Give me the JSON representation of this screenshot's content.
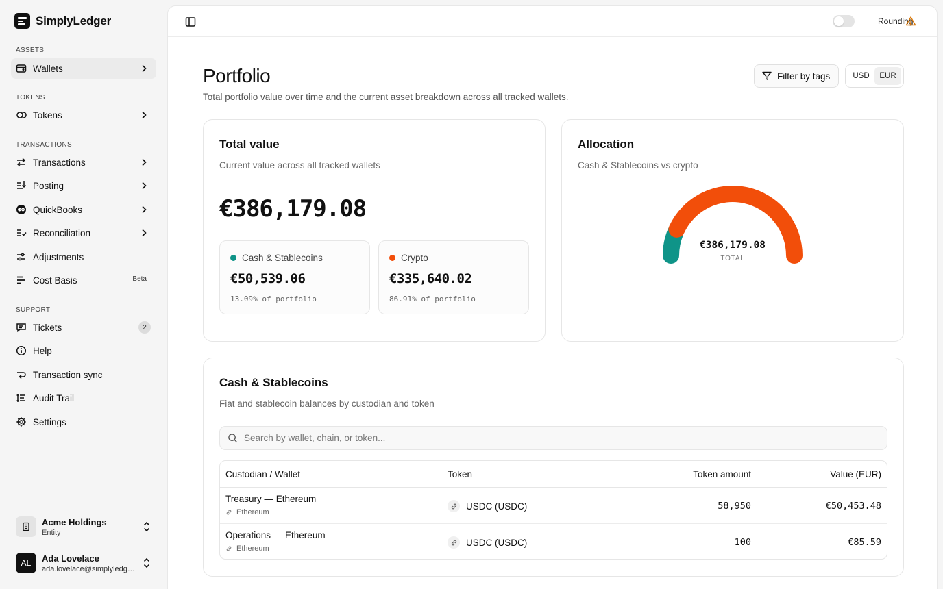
{
  "app": {
    "name": "SimplyLedger"
  },
  "sidebar": {
    "sections": [
      {
        "label": "Assets"
      },
      {
        "label": "Tokens"
      },
      {
        "label": "Transactions"
      },
      {
        "label": "Support"
      }
    ],
    "items": [
      {
        "label": "Wallets",
        "icon": "wallet-icon",
        "active": true
      },
      {
        "label": "Tokens",
        "icon": "coins-icon"
      },
      {
        "label": "Transactions",
        "icon": "arrows-icon"
      },
      {
        "label": "Posting",
        "icon": "posting-icon"
      },
      {
        "label": "QuickBooks",
        "icon": "quickbooks-icon"
      },
      {
        "label": "Reconciliation",
        "icon": "checklist-icon"
      },
      {
        "label": "Adjustments",
        "icon": "sliders-icon"
      },
      {
        "label": "Cost Basis",
        "icon": "cost-basis-icon",
        "badge": "Beta"
      },
      {
        "label": "Tickets",
        "icon": "ticket-icon",
        "count": "2"
      },
      {
        "label": "Help",
        "icon": "help-icon"
      },
      {
        "label": "Transaction sync",
        "icon": "sync-icon"
      },
      {
        "label": "Audit Trail",
        "icon": "audit-icon"
      },
      {
        "label": "Settings",
        "icon": "gear-icon"
      }
    ],
    "entity": {
      "name": "Acme Holdings",
      "type": "Entity"
    },
    "user": {
      "initials": "AL",
      "name": "Ada Lovelace",
      "email": "ada.lovelace@simplyledger.com"
    }
  },
  "topbar": {
    "rounding_label": "Rounding",
    "rounding_on": false
  },
  "page": {
    "title": "Portfolio",
    "subtitle": "Total portfolio value over time and the current asset breakdown across all tracked wallets.",
    "filter_label": "Filter by tags",
    "currencies": [
      "USD",
      "EUR"
    ],
    "selected_currency": "EUR"
  },
  "total_card": {
    "title": "Total value",
    "subtitle": "Current value across all tracked wallets",
    "value": "€386,179.08",
    "cash": {
      "label": "Cash & Stablecoins",
      "value": "€50,539.06",
      "pct": "13.09% of portfolio"
    },
    "crypto": {
      "label": "Crypto",
      "value": "€335,640.02",
      "pct": "86.91% of portfolio"
    }
  },
  "allocation_card": {
    "title": "Allocation",
    "subtitle": "Cash & Stablecoins vs crypto",
    "center_value": "€386,179.08",
    "center_label": "TOTAL"
  },
  "chart_data": {
    "type": "pie",
    "variant": "half-donut-gauge",
    "slices": [
      {
        "name": "Cash & Stablecoins",
        "value": 50539.06,
        "percent": 13.09,
        "color": "#0f9488"
      },
      {
        "name": "Crypto",
        "value": 335640.02,
        "percent": 86.91,
        "color": "#f24e0a"
      }
    ],
    "center_text": "€386,179.08",
    "center_label": "TOTAL"
  },
  "cash_card": {
    "title": "Cash & Stablecoins",
    "subtitle": "Fiat and stablecoin balances by custodian and token",
    "search_placeholder": "Search by wallet, chain, or token...",
    "columns": [
      "Custodian / Wallet",
      "Token",
      "Token amount",
      "Value (EUR)"
    ],
    "rows": [
      {
        "wallet": "Treasury — Ethereum",
        "chain": "Ethereum",
        "token": "USDC (USDC)",
        "amount": "58,950",
        "value": "€50,453.48"
      },
      {
        "wallet": "Operations — Ethereum",
        "chain": "Ethereum",
        "token": "USDC (USDC)",
        "amount": "100",
        "value": "€85.59"
      }
    ]
  },
  "colors": {
    "cash": "#0f9488",
    "crypto": "#f24e0a",
    "warning": "#d97706"
  }
}
